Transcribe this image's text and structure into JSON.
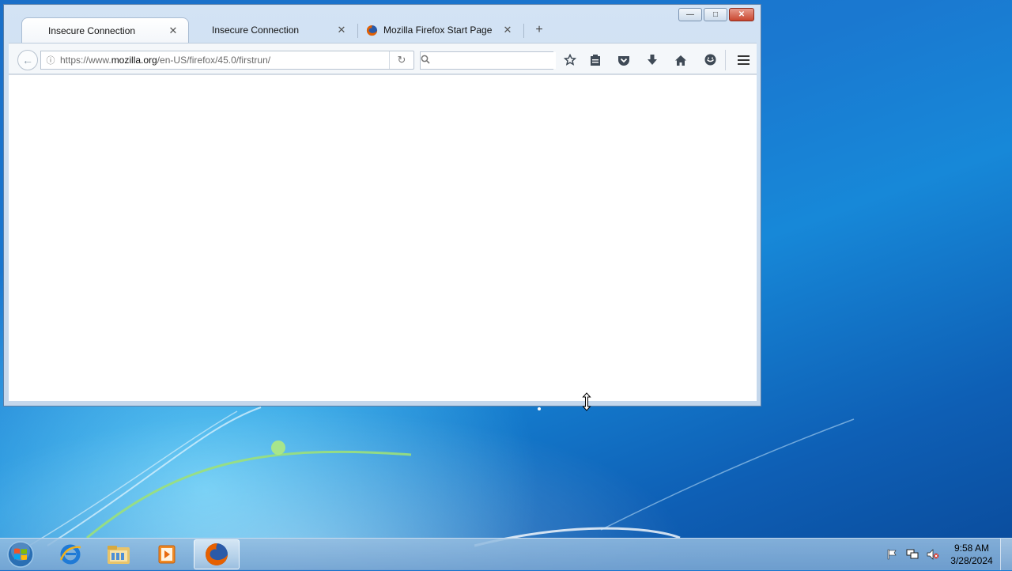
{
  "browser": {
    "tabs": [
      {
        "title": "Insecure Connection",
        "active": true
      },
      {
        "title": "Insecure Connection",
        "active": false
      },
      {
        "title": "Mozilla Firefox Start Page",
        "active": false,
        "icon": "firefox-icon"
      }
    ],
    "new_tab_label": "+",
    "url": {
      "prefix": "https://www.",
      "domain": "mozilla.org",
      "path": "/en-US/firefox/45.0/firstrun/"
    },
    "search_placeholder": "",
    "window_controls": {
      "minimize": "—",
      "maximize": "□",
      "close": "✕"
    }
  },
  "taskbar": {
    "items": [
      "start-orb",
      "internet-explorer-icon",
      "file-explorer-icon",
      "media-player-icon",
      "firefox-icon"
    ],
    "clock_time": "9:58 AM",
    "clock_date": "3/28/2024"
  },
  "colors": {
    "accent": "#1a78d0",
    "firefox_orange": "#e66000",
    "close_red": "#c9462f"
  }
}
